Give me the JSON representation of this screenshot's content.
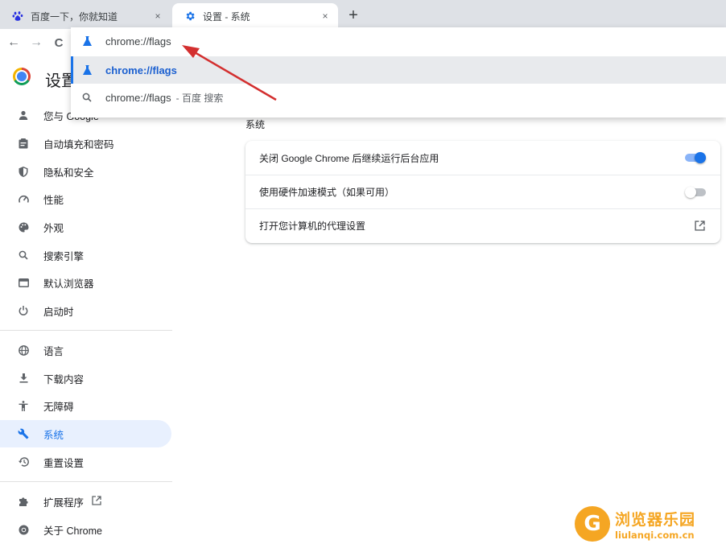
{
  "tabs": [
    {
      "title": "百度一下，你就知道",
      "icon": "baidu-paw-icon",
      "close": "×"
    },
    {
      "title": "设置 - 系统",
      "icon": "gear-icon",
      "close": "×"
    }
  ],
  "new_tab": "+",
  "toolbar": {
    "back": "←",
    "forward": "→",
    "reload": "C"
  },
  "omnibox": {
    "input_value": "chrome://flags",
    "suggestions": [
      {
        "text": "chrome://flags",
        "description": "",
        "icon": "flask-icon"
      },
      {
        "text": "chrome://flags",
        "description": "- 百度 搜索",
        "icon": "search-icon"
      }
    ]
  },
  "settings": {
    "title": "设置"
  },
  "sidebar": {
    "items": [
      {
        "label": "您与 Google",
        "icon": "person-icon"
      },
      {
        "label": "自动填充和密码",
        "icon": "clipboard-icon"
      },
      {
        "label": "隐私和安全",
        "icon": "shield-icon"
      },
      {
        "label": "性能",
        "icon": "speedometer-icon"
      },
      {
        "label": "外观",
        "icon": "palette-icon"
      },
      {
        "label": "搜索引擎",
        "icon": "search-icon"
      },
      {
        "label": "默认浏览器",
        "icon": "browser-window-icon"
      },
      {
        "label": "启动时",
        "icon": "power-icon"
      },
      {
        "label": "语言",
        "icon": "globe-icon"
      },
      {
        "label": "下载内容",
        "icon": "download-icon"
      },
      {
        "label": "无障碍",
        "icon": "accessibility-icon"
      },
      {
        "label": "系统",
        "icon": "wrench-icon",
        "active": true
      },
      {
        "label": "重置设置",
        "icon": "history-icon"
      },
      {
        "label": "扩展程序",
        "icon": "puzzle-icon"
      },
      {
        "label": "关于 Chrome",
        "icon": "chrome-icon"
      }
    ]
  },
  "main": {
    "section_title": "系统",
    "rows": [
      {
        "label": "关闭 Google Chrome 后继续运行后台应用",
        "control": "toggle",
        "on": true
      },
      {
        "label": "使用硬件加速模式（如果可用）",
        "control": "toggle",
        "on": false
      },
      {
        "label": "打开您计算机的代理设置",
        "control": "external-link-icon"
      }
    ]
  },
  "colors": {
    "accent": "#1a73e8",
    "annotation_arrow": "#d32f2f",
    "watermark": "#f5a623"
  },
  "watermark": {
    "name": "浏览器乐园",
    "url": "liulanqi.com.cn"
  }
}
